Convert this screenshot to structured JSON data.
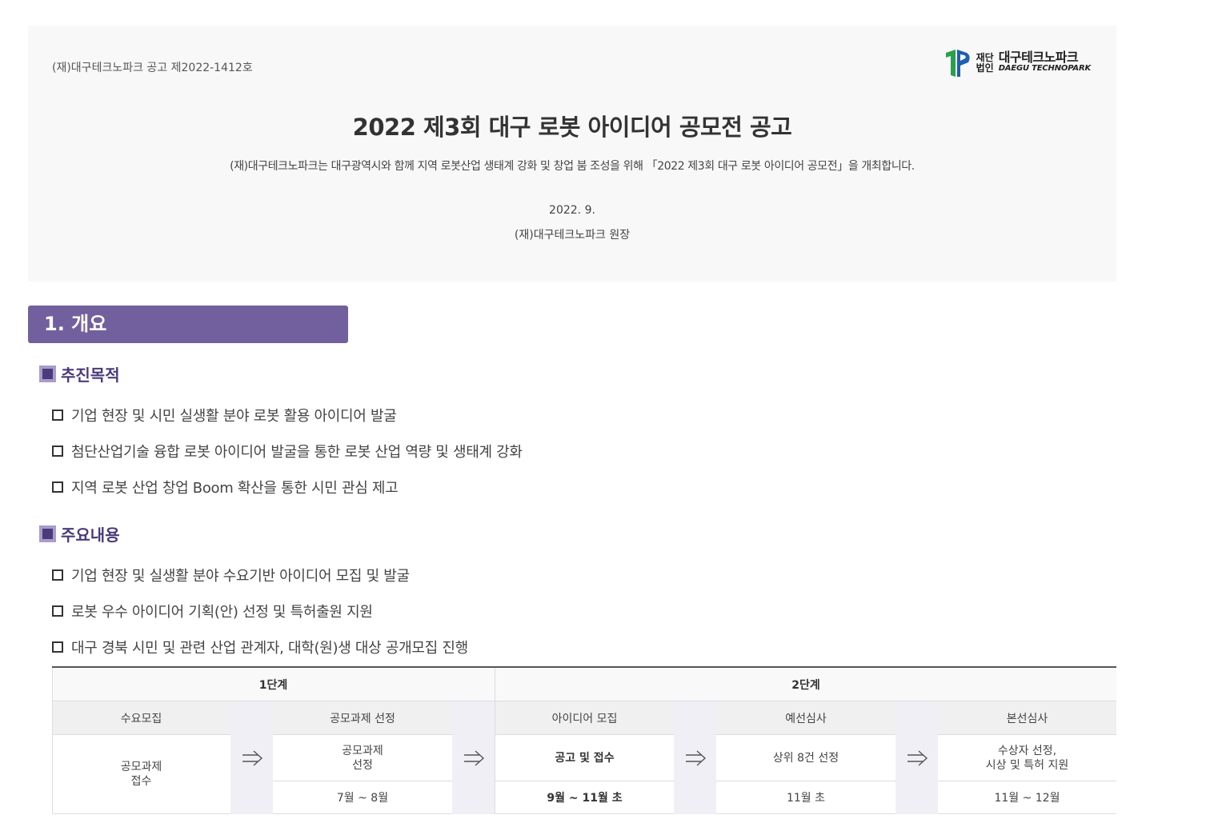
{
  "header": {
    "notice_no": "(재)대구테크노파크 공고 제2022-1412호",
    "logo": {
      "small_1": "재단",
      "small_2": "법인",
      "name_ko": "대구테크노파크",
      "name_en": "DAEGU TECHNOPARK"
    },
    "title": "2022 제3회 대구 로봇 아이디어 공모전 공고",
    "subtitle": "(재)대구테크노파크는 대구광역시와 함께 지역 로봇산업 생태계 강화 및 창업 붐 조성을 위해 「2022 제3회 대구 로봇 아이디어 공모전」을 개최합니다.",
    "date": "2022. 9.",
    "signer": "(재)대구테크노파크 원장"
  },
  "section": {
    "title": "1. 개요"
  },
  "purpose": {
    "heading": "추진목적",
    "items": [
      "기업 현장 및 시민 실생활 분야 로봇 활용 아이디어 발굴",
      "첨단산업기술 융합 로봇 아이디어 발굴을 통한 로봇 산업 역량 및 생태계 강화",
      "지역 로봇 산업 창업 Boom 확산을 통한 시민 관심 제고"
    ]
  },
  "content": {
    "heading": "주요내용",
    "items": [
      "기업 현장 및 실생활 분야 수요기반 아이디어 모집 및 발굴",
      "로봇 우수 아이디어 기획(안) 선정 및 특허출원 지원",
      "대구 경북 시민 및 관련 산업 관계자, 대학(원)생 대상 공개모집 진행"
    ]
  },
  "flow": {
    "stage1": "1단계",
    "stage2": "2단계",
    "steps": [
      {
        "head": "수요모집",
        "body_1": "공모과제",
        "body_2": "접수"
      },
      {
        "head": "공모과제 선정",
        "body_1": "공모과제",
        "body_2": "선정",
        "foot": "7월 ~ 8월"
      },
      {
        "head": "아이디어 모집",
        "body_1": "공고 및 접수",
        "foot": "9월 ~ 11월 초"
      },
      {
        "head": "예선심사",
        "body_1": "상위 8건 선정",
        "foot": "11월 초"
      },
      {
        "head": "본선심사",
        "body_1": "수상자 선정,",
        "body_2": "시상 및 특허 지원",
        "foot": "11월 ~ 12월"
      }
    ]
  },
  "colors": {
    "accent": "#72609e",
    "bullet_dark": "#4a3b7a",
    "bullet_light": "#a99bcc",
    "arrow_bg": "#f1eff6"
  }
}
